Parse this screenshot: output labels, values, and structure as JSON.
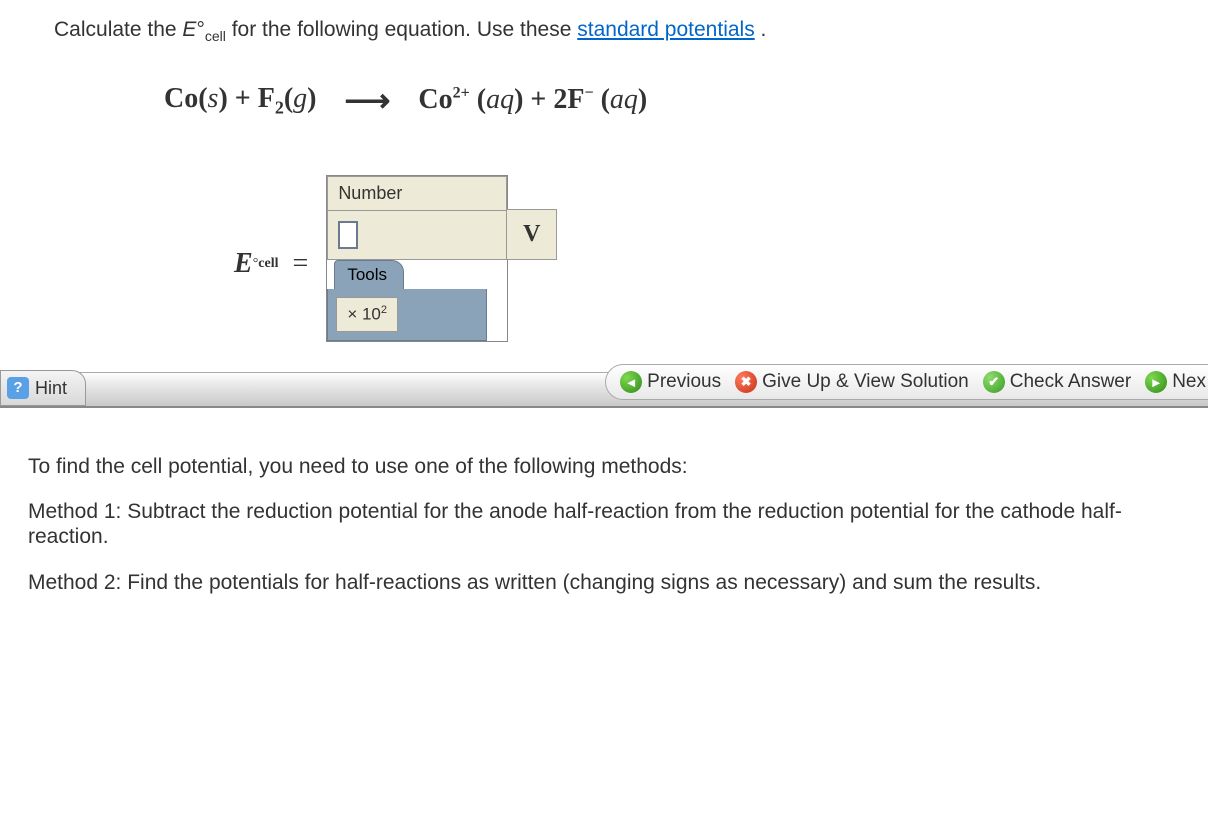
{
  "prompt": {
    "pre": "Calculate the ",
    "var_e": "E",
    "deg": "°",
    "var_sub": "cell",
    "mid": " for the following equation. Use these ",
    "link_text": "standard potentials",
    "post": " ."
  },
  "equation": {
    "lhs": "Co(s) + F₂(g)",
    "rhs": "Co²⁺ (aq) + 2F⁻ (aq)"
  },
  "widget": {
    "number_label": "Number",
    "unit": "V",
    "tools_label": "Tools",
    "sci_btn": "× 10",
    "sci_exp": "2",
    "value": ""
  },
  "ecell_label": {
    "E": "E",
    "sub": "cell",
    "equals": "="
  },
  "nav": {
    "hint": "Hint",
    "previous": "Previous",
    "giveup": "Give Up & View Solution",
    "check": "Check Answer",
    "next": "Nex"
  },
  "methods": {
    "intro": "To find the cell potential, you need to use one of the following methods:",
    "m1": "Method 1: Subtract the reduction potential for the anode half-reaction from the reduction potential for the cathode half-reaction.",
    "m2": "Method 2: Find the potentials for half-reactions as written (changing signs as necessary) and sum the results."
  }
}
